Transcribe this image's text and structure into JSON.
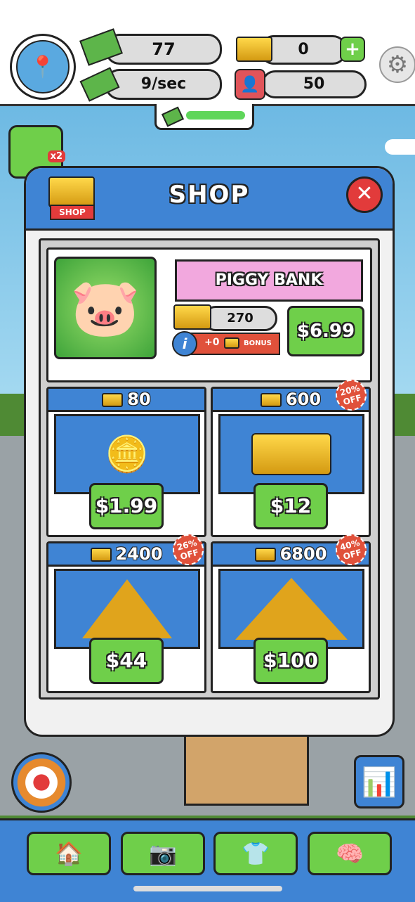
{
  "top": {
    "cash": "77",
    "rate": "9/sec",
    "gold": "0",
    "people": "50",
    "boost_multiplier": "x2"
  },
  "shop": {
    "title": "SHOP",
    "badge": "SHOP",
    "close_symbol": "✕",
    "piggy": {
      "title": "PIGGY BANK",
      "gold_amount": "270",
      "bonus_text": "+0",
      "bonus_label": "BONUS",
      "price": "$6.99"
    },
    "packs": [
      {
        "amount": "80",
        "price": "$1.99",
        "discount": ""
      },
      {
        "amount": "600",
        "price": "$12",
        "discount": "20% OFF"
      },
      {
        "amount": "2400",
        "price": "$44",
        "discount": "26% OFF"
      },
      {
        "amount": "6800",
        "price": "$100",
        "discount": "40% OFF"
      }
    ]
  },
  "colors": {
    "accent_blue": "#3f84d4",
    "button_green": "#6fcf4a",
    "close_red": "#e23b3b",
    "piggy_pink": "#f2a8de"
  },
  "nav": {
    "items": [
      "home-icon",
      "camera-icon",
      "outfit-icon",
      "brain-icon"
    ]
  }
}
